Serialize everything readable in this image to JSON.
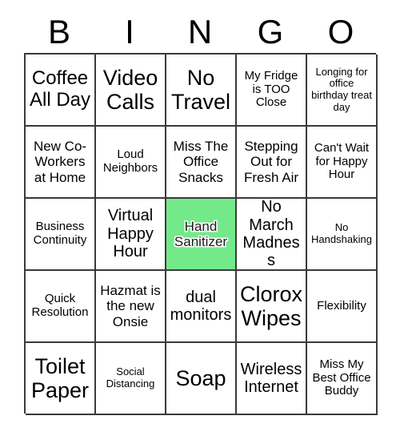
{
  "card": {
    "title": "BINGO",
    "header_letters": [
      "B",
      "I",
      "N",
      "G",
      "O"
    ],
    "marked_color": "#74E98A",
    "border_color": "#3a3a3a",
    "background_color": "#ffffff",
    "text_color": "#000000",
    "columns": 5,
    "rows": 5,
    "cells": [
      {
        "text": "Coffee All Day",
        "marked": false,
        "size": "lg"
      },
      {
        "text": "Video Calls",
        "marked": false,
        "size": "xl"
      },
      {
        "text": "No Travel",
        "marked": false,
        "size": "xl"
      },
      {
        "text": "My Fridge is TOO Close",
        "marked": false,
        "size": "xs"
      },
      {
        "text": "Longing for office birthday treat day",
        "marked": false,
        "size": "xxs"
      },
      {
        "text": "New Co-Workers at Home",
        "marked": false,
        "size": "sm"
      },
      {
        "text": "Loud Neighbors",
        "marked": false,
        "size": "xs"
      },
      {
        "text": "Miss The Office Snacks",
        "marked": false,
        "size": "sm"
      },
      {
        "text": "Stepping Out for Fresh Air",
        "marked": false,
        "size": "sm"
      },
      {
        "text": "Can't Wait for Happy Hour",
        "marked": false,
        "size": "xs"
      },
      {
        "text": "Business Continuity",
        "marked": false,
        "size": "xs"
      },
      {
        "text": "Virtual Happy Hour",
        "marked": false,
        "size": "md"
      },
      {
        "text": "Hand Sanitizer",
        "marked": true,
        "size": "sm"
      },
      {
        "text": "No March Madness",
        "marked": false,
        "size": "md"
      },
      {
        "text": "No Handshaking",
        "marked": false,
        "size": "xxs"
      },
      {
        "text": "Quick Resolution",
        "marked": false,
        "size": "xs"
      },
      {
        "text": "Hazmat is the new Onsie",
        "marked": false,
        "size": "sm"
      },
      {
        "text": "dual monitors",
        "marked": false,
        "size": "md"
      },
      {
        "text": "Clorox Wipes",
        "marked": false,
        "size": "xl"
      },
      {
        "text": "Flexibility",
        "marked": false,
        "size": "xs"
      },
      {
        "text": "Toilet Paper",
        "marked": false,
        "size": "xl"
      },
      {
        "text": "Social Distancing",
        "marked": false,
        "size": "xxs"
      },
      {
        "text": "Soap",
        "marked": false,
        "size": "xl"
      },
      {
        "text": "Wireless Internet",
        "marked": false,
        "size": "md"
      },
      {
        "text": "Miss My Best Office Buddy",
        "marked": false,
        "size": "xs"
      }
    ]
  }
}
